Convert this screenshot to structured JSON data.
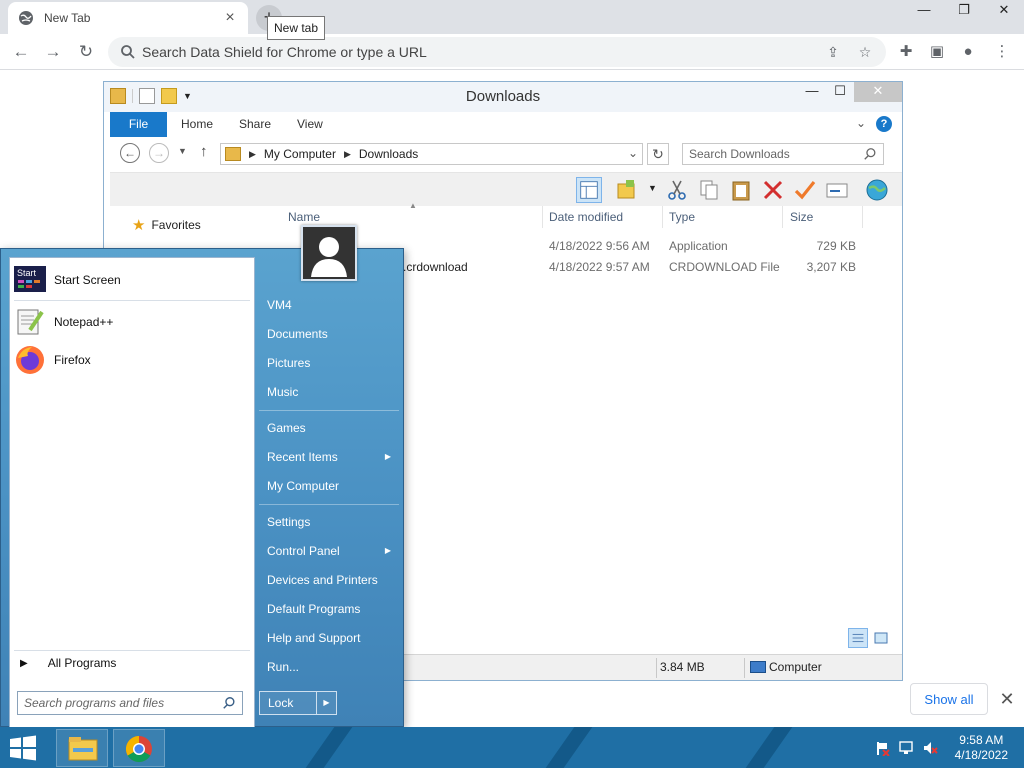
{
  "chrome": {
    "tab_title": "New Tab",
    "tab_close": "×",
    "newtab_symbol": "+",
    "tooltip": "New tab",
    "omnibox_placeholder": "Search Data Shield for Chrome or type a URL",
    "minimize": "—",
    "restore": "❐",
    "close": "✕"
  },
  "explorer": {
    "title": "Downloads",
    "ribbon_tabs": [
      "File",
      "Home",
      "Share",
      "View"
    ],
    "breadcrumb": [
      "My Computer",
      "Downloads"
    ],
    "search_placeholder": "Search Downloads",
    "nav": {
      "favorites": "Favorites"
    },
    "columns": {
      "name": "Name",
      "date": "Date modified",
      "type": "Type",
      "size": "Size"
    },
    "files": [
      {
        "name": "",
        "date": "4/18/2022 9:56 AM",
        "type": "Application",
        "size": "729 KB"
      },
      {
        "name": "988.crdownload",
        "date": "4/18/2022 9:57 AM",
        "type": "CRDOWNLOAD File",
        "size": "3,207 KB"
      }
    ],
    "status": {
      "size": "3.84 MB",
      "location": "Computer"
    }
  },
  "shelf": {
    "show_all": "Show all",
    "close": "✕"
  },
  "startmenu": {
    "pinned": [
      {
        "label": "Start Screen",
        "icon_text": "Start"
      },
      {
        "label": "Notepad++"
      },
      {
        "label": "Firefox"
      }
    ],
    "all_programs": "All Programs",
    "search_placeholder": "Search programs and files",
    "right": {
      "user": "VM4",
      "documents": "Documents",
      "pictures": "Pictures",
      "music": "Music",
      "games": "Games",
      "recent": "Recent Items",
      "computer": "My Computer",
      "settings": "Settings",
      "control_panel": "Control Panel",
      "devices": "Devices and Printers",
      "defaults": "Default Programs",
      "help": "Help and Support",
      "run": "Run..."
    },
    "lock": "Lock"
  },
  "taskbar": {
    "time": "9:58 AM",
    "date": "4/18/2022"
  },
  "colors": {
    "accent": "#1979ca",
    "taskbar": "#1f6fa5",
    "startmenu": "#4b92c4"
  }
}
